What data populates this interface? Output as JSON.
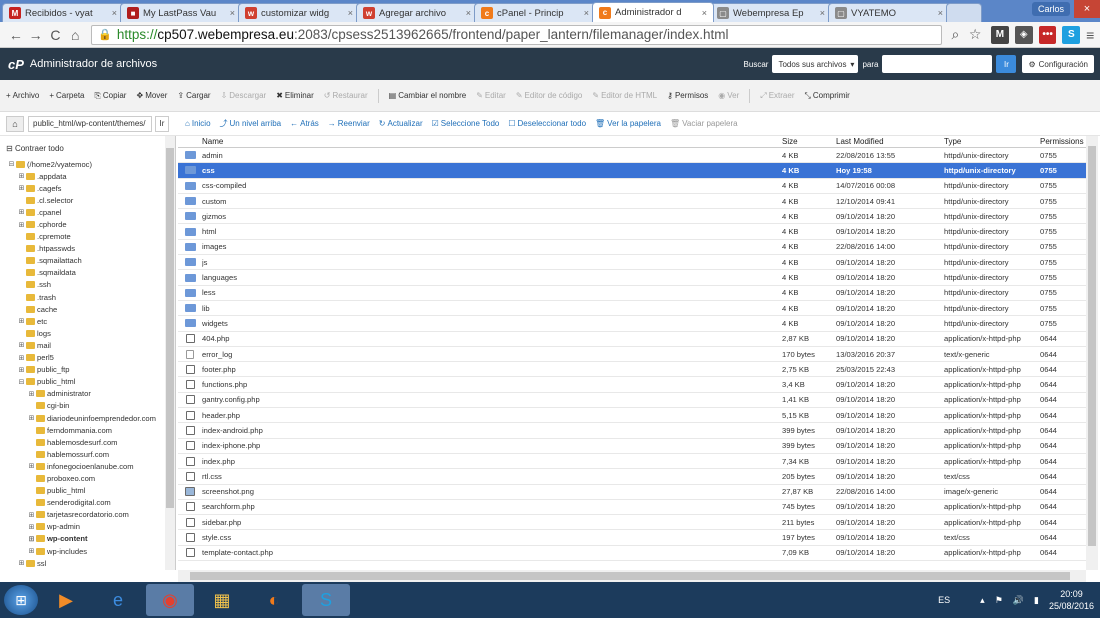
{
  "browser": {
    "tabs": [
      {
        "label": "Recibidos - vyat",
        "fav": "M",
        "color": "#c5221f"
      },
      {
        "label": "My LastPass Vau",
        "fav": "■",
        "color": "#b01e1e"
      },
      {
        "label": "customizar widg",
        "fav": "w",
        "color": "#d04030"
      },
      {
        "label": "Agregar archivo",
        "fav": "w",
        "color": "#d04030"
      },
      {
        "label": "cPanel - Princip",
        "fav": "c",
        "color": "#f07a1a"
      },
      {
        "label": "Administrador d",
        "fav": "c",
        "color": "#f07a1a",
        "active": true
      },
      {
        "label": "Webempresa Ep",
        "fav": "▢",
        "color": "#8a8a8a"
      },
      {
        "label": "VYATEMO",
        "fav": "▢",
        "color": "#8a8a8a"
      }
    ],
    "user": "Carlos",
    "url_scheme": "https://",
    "url_host": "cp507.webempresa.eu",
    "url_rest": ":2083/cpsess2513962665/frontend/paper_lantern/filemanager/index.html"
  },
  "cpanel": {
    "logo": "cP",
    "title": "Administrador de archivos",
    "search_label": "Buscar",
    "search_scope": "Todos sus archivos",
    "para_label": "para",
    "go_label": "Ir",
    "settings_label": "Configuración"
  },
  "toolbar": [
    {
      "icon": "+",
      "label": "Archivo",
      "name": "new-file-button"
    },
    {
      "icon": "+",
      "label": "Carpeta",
      "name": "new-folder-button"
    },
    {
      "icon": "⎘",
      "label": "Copiar",
      "name": "copy-button"
    },
    {
      "icon": "✥",
      "label": "Mover",
      "name": "move-button"
    },
    {
      "icon": "⇪",
      "label": "Cargar",
      "name": "upload-button"
    },
    {
      "icon": "⇩",
      "label": "Descargar",
      "name": "download-button",
      "disabled": true
    },
    {
      "icon": "✖",
      "label": "Eliminar",
      "name": "delete-button"
    },
    {
      "icon": "↺",
      "label": "Restaurar",
      "name": "restore-button",
      "disabled": true
    },
    {
      "sep": true
    },
    {
      "icon": "▤",
      "label": "Cambiar el nombre",
      "name": "rename-button"
    },
    {
      "icon": "✎",
      "label": "Editar",
      "name": "edit-button",
      "disabled": true
    },
    {
      "icon": "✎",
      "label": "Editor de código",
      "name": "code-editor-button",
      "disabled": true
    },
    {
      "icon": "✎",
      "label": "Editor de HTML",
      "name": "html-editor-button",
      "disabled": true
    },
    {
      "icon": "⚷",
      "label": "Permisos",
      "name": "permissions-button"
    },
    {
      "icon": "◉",
      "label": "Ver",
      "name": "view-button",
      "disabled": true
    },
    {
      "sep": true
    },
    {
      "icon": "⤢",
      "label": "Extraer",
      "name": "extract-button",
      "disabled": true
    },
    {
      "icon": "⤡",
      "label": "Comprimir",
      "name": "compress-button"
    }
  ],
  "pathbar": {
    "path": "public_html/wp-content/themes/",
    "go": "Ir",
    "actions": [
      {
        "icon": "⌂",
        "label": "Inicio",
        "name": "home-action"
      },
      {
        "icon": "⤴",
        "label": "Un nivel arriba",
        "name": "up-level-action"
      },
      {
        "icon": "←",
        "label": "Atrás",
        "name": "back-action"
      },
      {
        "icon": "→",
        "label": "Reenviar",
        "name": "forward-action"
      },
      {
        "icon": "↻",
        "label": "Actualizar",
        "name": "refresh-action"
      },
      {
        "icon": "☑",
        "label": "Seleccione Todo",
        "name": "select-all-action"
      },
      {
        "icon": "☐",
        "label": "Deseleccionar todo",
        "name": "deselect-all-action"
      },
      {
        "icon": "🗑",
        "label": "Ver la papelera",
        "name": "view-trash-action"
      },
      {
        "icon": "🗑",
        "label": "Vaciar papelera",
        "name": "empty-trash-action",
        "disabled": true
      }
    ]
  },
  "sidebar": {
    "collapse_label": "Contraer todo",
    "tree": [
      {
        "label": "(/home2/vyatemoc)",
        "depth": 0,
        "pm": "⊟",
        "home": true
      },
      {
        "label": ".appdata",
        "depth": 1,
        "pm": "⊞"
      },
      {
        "label": ".cagefs",
        "depth": 1,
        "pm": "⊞"
      },
      {
        "label": ".cl.selector",
        "depth": 1,
        "pm": ""
      },
      {
        "label": ".cpanel",
        "depth": 1,
        "pm": "⊞"
      },
      {
        "label": ".cphorde",
        "depth": 1,
        "pm": "⊞"
      },
      {
        "label": ".cpremote",
        "depth": 1,
        "pm": ""
      },
      {
        "label": ".htpasswds",
        "depth": 1,
        "pm": ""
      },
      {
        "label": ".sqmailattach",
        "depth": 1,
        "pm": ""
      },
      {
        "label": ".sqmaildata",
        "depth": 1,
        "pm": ""
      },
      {
        "label": ".ssh",
        "depth": 1,
        "pm": ""
      },
      {
        "label": ".trash",
        "depth": 1,
        "pm": ""
      },
      {
        "label": "cache",
        "depth": 1,
        "pm": ""
      },
      {
        "label": "etc",
        "depth": 1,
        "pm": "⊞"
      },
      {
        "label": "logs",
        "depth": 1,
        "pm": ""
      },
      {
        "label": "mail",
        "depth": 1,
        "pm": "⊞"
      },
      {
        "label": "perl5",
        "depth": 1,
        "pm": "⊞"
      },
      {
        "label": "public_ftp",
        "depth": 1,
        "pm": "⊞"
      },
      {
        "label": "public_html",
        "depth": 1,
        "pm": "⊟"
      },
      {
        "label": "administrator",
        "depth": 2,
        "pm": "⊞"
      },
      {
        "label": "cgi-bin",
        "depth": 2,
        "pm": ""
      },
      {
        "label": "diariodeuninfoemprendedor.com",
        "depth": 2,
        "pm": "⊞"
      },
      {
        "label": "ferndommania.com",
        "depth": 2,
        "pm": ""
      },
      {
        "label": "hablemosdesurf.com",
        "depth": 2,
        "pm": ""
      },
      {
        "label": "hablemossurf.com",
        "depth": 2,
        "pm": ""
      },
      {
        "label": "infonegocioenlanube.com",
        "depth": 2,
        "pm": "⊞"
      },
      {
        "label": "proboxeo.com",
        "depth": 2,
        "pm": ""
      },
      {
        "label": "public_html",
        "depth": 2,
        "pm": ""
      },
      {
        "label": "senderodigital.com",
        "depth": 2,
        "pm": ""
      },
      {
        "label": "tarjetasrecordatorio.com",
        "depth": 2,
        "pm": "⊞"
      },
      {
        "label": "wp-admin",
        "depth": 2,
        "pm": "⊞"
      },
      {
        "label": "wp-content",
        "depth": 2,
        "pm": "⊞",
        "bold": true
      },
      {
        "label": "wp-includes",
        "depth": 2,
        "pm": "⊞"
      },
      {
        "label": "ssl",
        "depth": 1,
        "pm": "⊞"
      }
    ]
  },
  "grid": {
    "headers": {
      "name": "Name",
      "size": "Size",
      "modified": "Last Modified",
      "type": "Type",
      "perm": "Permissions"
    },
    "rows": [
      {
        "kind": "dir",
        "name": "admin",
        "size": "4 KB",
        "mod": "22/08/2016 13:55",
        "type": "httpd/unix-directory",
        "perm": "0755"
      },
      {
        "kind": "dir",
        "name": "css",
        "size": "4 KB",
        "mod": "Hoy 19:58",
        "type": "httpd/unix-directory",
        "perm": "0755",
        "selected": true
      },
      {
        "kind": "dir",
        "name": "css-compiled",
        "size": "4 KB",
        "mod": "14/07/2016 00:08",
        "type": "httpd/unix-directory",
        "perm": "0755"
      },
      {
        "kind": "dir",
        "name": "custom",
        "size": "4 KB",
        "mod": "12/10/2014 09:41",
        "type": "httpd/unix-directory",
        "perm": "0755"
      },
      {
        "kind": "dir",
        "name": "gizmos",
        "size": "4 KB",
        "mod": "09/10/2014 18:20",
        "type": "httpd/unix-directory",
        "perm": "0755"
      },
      {
        "kind": "dir",
        "name": "html",
        "size": "4 KB",
        "mod": "09/10/2014 18:20",
        "type": "httpd/unix-directory",
        "perm": "0755"
      },
      {
        "kind": "dir",
        "name": "images",
        "size": "4 KB",
        "mod": "22/08/2016 14:00",
        "type": "httpd/unix-directory",
        "perm": "0755"
      },
      {
        "kind": "dir",
        "name": "js",
        "size": "4 KB",
        "mod": "09/10/2014 18:20",
        "type": "httpd/unix-directory",
        "perm": "0755"
      },
      {
        "kind": "dir",
        "name": "languages",
        "size": "4 KB",
        "mod": "09/10/2014 18:20",
        "type": "httpd/unix-directory",
        "perm": "0755"
      },
      {
        "kind": "dir",
        "name": "less",
        "size": "4 KB",
        "mod": "09/10/2014 18:20",
        "type": "httpd/unix-directory",
        "perm": "0755"
      },
      {
        "kind": "dir",
        "name": "lib",
        "size": "4 KB",
        "mod": "09/10/2014 18:20",
        "type": "httpd/unix-directory",
        "perm": "0755"
      },
      {
        "kind": "dir",
        "name": "widgets",
        "size": "4 KB",
        "mod": "09/10/2014 18:20",
        "type": "httpd/unix-directory",
        "perm": "0755"
      },
      {
        "kind": "php",
        "name": "404.php",
        "size": "2,87 KB",
        "mod": "09/10/2014 18:20",
        "type": "application/x-httpd-php",
        "perm": "0644"
      },
      {
        "kind": "txt",
        "name": "error_log",
        "size": "170 bytes",
        "mod": "13/03/2016 20:37",
        "type": "text/x-generic",
        "perm": "0644"
      },
      {
        "kind": "php",
        "name": "footer.php",
        "size": "2,75 KB",
        "mod": "25/03/2015 22:43",
        "type": "application/x-httpd-php",
        "perm": "0644"
      },
      {
        "kind": "php",
        "name": "functions.php",
        "size": "3,4 KB",
        "mod": "09/10/2014 18:20",
        "type": "application/x-httpd-php",
        "perm": "0644"
      },
      {
        "kind": "php",
        "name": "gantry.config.php",
        "size": "1,41 KB",
        "mod": "09/10/2014 18:20",
        "type": "application/x-httpd-php",
        "perm": "0644"
      },
      {
        "kind": "php",
        "name": "header.php",
        "size": "5,15 KB",
        "mod": "09/10/2014 18:20",
        "type": "application/x-httpd-php",
        "perm": "0644"
      },
      {
        "kind": "php",
        "name": "index-android.php",
        "size": "399 bytes",
        "mod": "09/10/2014 18:20",
        "type": "application/x-httpd-php",
        "perm": "0644"
      },
      {
        "kind": "php",
        "name": "index-iphone.php",
        "size": "399 bytes",
        "mod": "09/10/2014 18:20",
        "type": "application/x-httpd-php",
        "perm": "0644"
      },
      {
        "kind": "php",
        "name": "index.php",
        "size": "7,34 KB",
        "mod": "09/10/2014 18:20",
        "type": "application/x-httpd-php",
        "perm": "0644"
      },
      {
        "kind": "css",
        "name": "rtl.css",
        "size": "205 bytes",
        "mod": "09/10/2014 18:20",
        "type": "text/css",
        "perm": "0644"
      },
      {
        "kind": "img",
        "name": "screenshot.png",
        "size": "27,87 KB",
        "mod": "22/08/2016 14:00",
        "type": "image/x-generic",
        "perm": "0644"
      },
      {
        "kind": "php",
        "name": "searchform.php",
        "size": "745 bytes",
        "mod": "09/10/2014 18:20",
        "type": "application/x-httpd-php",
        "perm": "0644"
      },
      {
        "kind": "php",
        "name": "sidebar.php",
        "size": "211 bytes",
        "mod": "09/10/2014 18:20",
        "type": "application/x-httpd-php",
        "perm": "0644"
      },
      {
        "kind": "css",
        "name": "style.css",
        "size": "197 bytes",
        "mod": "09/10/2014 18:20",
        "type": "text/css",
        "perm": "0644"
      },
      {
        "kind": "php",
        "name": "template-contact.php",
        "size": "7,09 KB",
        "mod": "09/10/2014 18:20",
        "type": "application/x-httpd-php",
        "perm": "0644"
      }
    ]
  },
  "taskbar": {
    "apps": [
      {
        "name": "media-player-app",
        "glyph": "▶",
        "color": "#f28c28"
      },
      {
        "name": "internet-explorer-app",
        "glyph": "e",
        "color": "#3c8ce0"
      },
      {
        "name": "chrome-app",
        "glyph": "◉",
        "color": "#e4402e",
        "on": true
      },
      {
        "name": "file-explorer-app",
        "glyph": "▦",
        "color": "#f1c24b"
      },
      {
        "name": "firefox-app",
        "glyph": "◐",
        "color": "#f07a1a"
      },
      {
        "name": "skype-app",
        "glyph": "S",
        "color": "#1ea0e0",
        "on": true
      }
    ],
    "lang": "ES",
    "time": "20:09",
    "date": "25/08/2016"
  }
}
